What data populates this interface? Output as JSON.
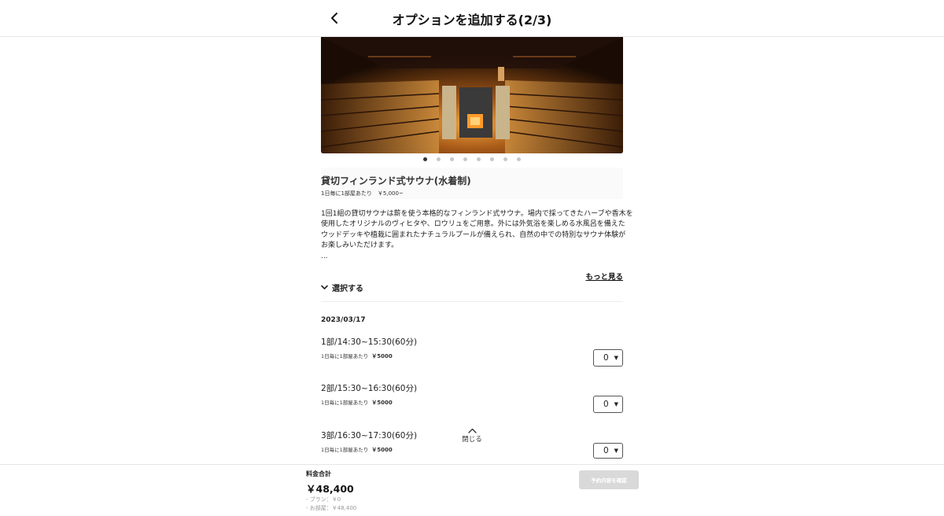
{
  "header": {
    "title": "オプションを追加する(2/3)"
  },
  "carousel": {
    "count": 8,
    "active_index": 0
  },
  "option": {
    "title": "貸切フィンランド式サウナ(水着制)",
    "price_note": "1日毎に1部屋あたり　￥5,000~"
  },
  "description": {
    "lines": [
      "1回1組の貸切サウナは薪を使う本格的なフィンランド式サウナ。場内で採ってきたハーブや香木を",
      "使用したオリジナルのヴィヒタや、ロウリュをご用意。外には外気浴を楽しめる水風呂を備えた",
      "ウッドデッキや植栽に囲まれたナチュラルプールが備えられ、自然の中での特別なサウナ体験が",
      "お楽しみいただけます。",
      "..."
    ],
    "more_label": "もっと見る"
  },
  "select_toggle_label": "選択する",
  "date": "2023/03/17",
  "slots": [
    {
      "name": "1部/14:30~15:30(60分)",
      "unit": "1日毎に1部屋あたり",
      "price": "￥5000",
      "qty": "0"
    },
    {
      "name": "2部/15:30~16:30(60分)",
      "unit": "1日毎に1部屋あたり",
      "price": "￥5000",
      "qty": "0"
    },
    {
      "name": "3部/16:30~17:30(60分)",
      "unit": "1日毎に1部屋あたり",
      "price": "￥5000",
      "qty": "0"
    }
  ],
  "close_label": "閉じる",
  "footer": {
    "total_label": "料金合計",
    "total_amount": "￥48,400",
    "breakdown": [
      "- プラン：￥0",
      "- お部屋：￥48,400"
    ],
    "confirm_label": "予約内容を確認"
  },
  "colors": {
    "accent_disabled": "#d9d9d9",
    "text": "#222222",
    "divider": "#ececec"
  }
}
